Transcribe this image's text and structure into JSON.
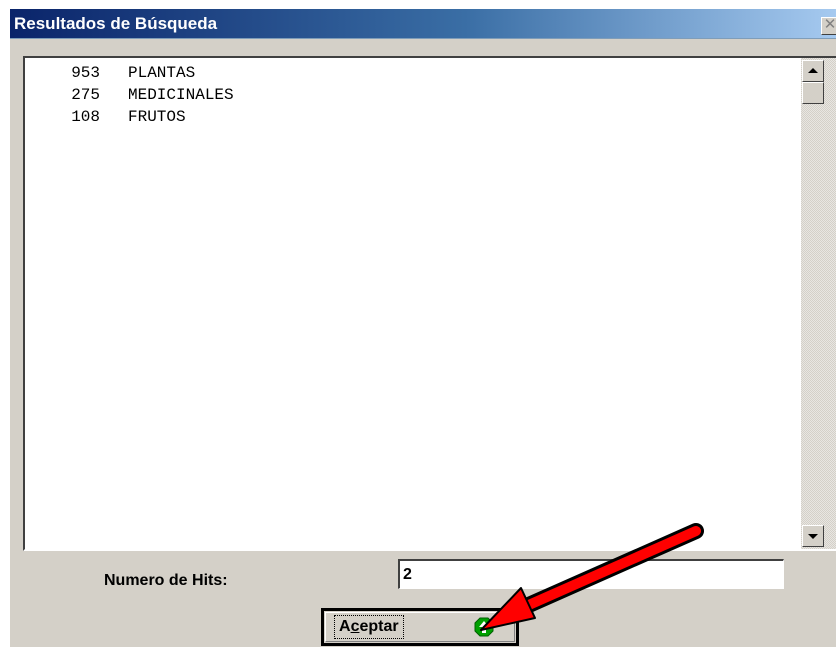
{
  "window": {
    "title": "Resultados de Búsqueda",
    "close_glyph": "✕"
  },
  "results": [
    {
      "count": "953",
      "term": "PLANTAS"
    },
    {
      "count": "275",
      "term": "MEDICINALES"
    },
    {
      "count": "108",
      "term": "FRUTOS"
    }
  ],
  "hits": {
    "label": "Numero de Hits:",
    "value": "2"
  },
  "accept_button": {
    "label_prefix": "A",
    "label_mnemonic": "c",
    "label_suffix": "eptar",
    "icon": "green-up-arrow-icon"
  },
  "annotation": {
    "icon": "red-pointer-arrow",
    "color": "#ff0000"
  },
  "colors": {
    "title_gradient_start": "#0a246a",
    "title_gradient_end": "#a6caf0",
    "face": "#d4d0c8",
    "icon_green": "#00a000"
  }
}
